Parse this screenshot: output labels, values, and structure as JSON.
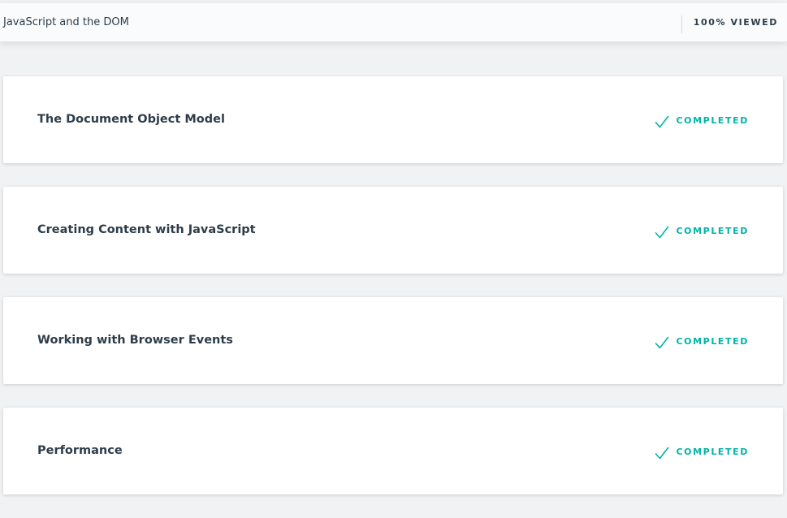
{
  "header": {
    "title": "JavaScript and the DOM",
    "progress": "100% VIEWED"
  },
  "lessons": [
    {
      "title": "The Document Object Model",
      "status": "COMPLETED",
      "status_icon": "checkmark-icon"
    },
    {
      "title": "Creating Content with JavaScript",
      "status": "COMPLETED",
      "status_icon": "checkmark-icon"
    },
    {
      "title": "Working with Browser Events",
      "status": "COMPLETED",
      "status_icon": "checkmark-icon"
    },
    {
      "title": "Performance",
      "status": "COMPLETED",
      "status_icon": "checkmark-icon"
    }
  ],
  "colors": {
    "accent": "#02b3a7",
    "text": "#2e3d49",
    "background": "#f1f2f4",
    "card": "#ffffff"
  }
}
